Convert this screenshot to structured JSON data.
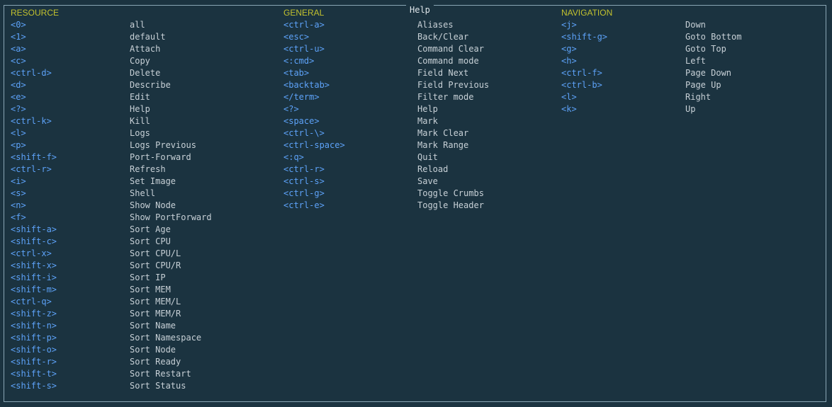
{
  "window": {
    "title": "Help"
  },
  "colors": {
    "background": "#1b3340",
    "border": "#8aa6b4",
    "section_title": "#c2c12e",
    "key": "#5da2f8",
    "description": "#c7d0d6"
  },
  "sections": [
    {
      "title": "RESOURCE",
      "items": [
        {
          "key": "<0>",
          "desc": "all"
        },
        {
          "key": "<1>",
          "desc": "default"
        },
        {
          "key": "<a>",
          "desc": "Attach"
        },
        {
          "key": "<c>",
          "desc": "Copy"
        },
        {
          "key": "<ctrl-d>",
          "desc": "Delete"
        },
        {
          "key": "<d>",
          "desc": "Describe"
        },
        {
          "key": "<e>",
          "desc": "Edit"
        },
        {
          "key": "<?>",
          "desc": "Help"
        },
        {
          "key": "<ctrl-k>",
          "desc": "Kill"
        },
        {
          "key": "<l>",
          "desc": "Logs"
        },
        {
          "key": "<p>",
          "desc": "Logs Previous"
        },
        {
          "key": "<shift-f>",
          "desc": "Port-Forward"
        },
        {
          "key": "<ctrl-r>",
          "desc": "Refresh"
        },
        {
          "key": "<i>",
          "desc": "Set Image"
        },
        {
          "key": "<s>",
          "desc": "Shell"
        },
        {
          "key": "<n>",
          "desc": "Show Node"
        },
        {
          "key": "<f>",
          "desc": "Show PortForward"
        },
        {
          "key": "<shift-a>",
          "desc": "Sort Age"
        },
        {
          "key": "<shift-c>",
          "desc": "Sort CPU"
        },
        {
          "key": "<ctrl-x>",
          "desc": "Sort CPU/L"
        },
        {
          "key": "<shift-x>",
          "desc": "Sort CPU/R"
        },
        {
          "key": "<shift-i>",
          "desc": "Sort IP"
        },
        {
          "key": "<shift-m>",
          "desc": "Sort MEM"
        },
        {
          "key": "<ctrl-q>",
          "desc": "Sort MEM/L"
        },
        {
          "key": "<shift-z>",
          "desc": "Sort MEM/R"
        },
        {
          "key": "<shift-n>",
          "desc": "Sort Name"
        },
        {
          "key": "<shift-p>",
          "desc": "Sort Namespace"
        },
        {
          "key": "<shift-o>",
          "desc": "Sort Node"
        },
        {
          "key": "<shift-r>",
          "desc": "Sort Ready"
        },
        {
          "key": "<shift-t>",
          "desc": "Sort Restart"
        },
        {
          "key": "<shift-s>",
          "desc": "Sort Status"
        }
      ]
    },
    {
      "title": "GENERAL",
      "items": [
        {
          "key": "<ctrl-a>",
          "desc": "Aliases"
        },
        {
          "key": "<esc>",
          "desc": "Back/Clear"
        },
        {
          "key": "<ctrl-u>",
          "desc": "Command Clear"
        },
        {
          "key": "<:cmd>",
          "desc": "Command mode"
        },
        {
          "key": "<tab>",
          "desc": "Field Next"
        },
        {
          "key": "<backtab>",
          "desc": "Field Previous"
        },
        {
          "key": "</term>",
          "desc": "Filter mode"
        },
        {
          "key": "<?>",
          "desc": "Help"
        },
        {
          "key": "<space>",
          "desc": "Mark"
        },
        {
          "key": "<ctrl-\\>",
          "desc": "Mark Clear"
        },
        {
          "key": "<ctrl-space>",
          "desc": "Mark Range"
        },
        {
          "key": "<:q>",
          "desc": "Quit"
        },
        {
          "key": "<ctrl-r>",
          "desc": "Reload"
        },
        {
          "key": "<ctrl-s>",
          "desc": "Save"
        },
        {
          "key": "<ctrl-g>",
          "desc": "Toggle Crumbs"
        },
        {
          "key": "<ctrl-e>",
          "desc": "Toggle Header"
        }
      ]
    },
    {
      "title": "NAVIGATION",
      "items": [
        {
          "key": "<j>",
          "desc": "Down"
        },
        {
          "key": "<shift-g>",
          "desc": "Goto Bottom"
        },
        {
          "key": "<g>",
          "desc": "Goto Top"
        },
        {
          "key": "<h>",
          "desc": "Left"
        },
        {
          "key": "<ctrl-f>",
          "desc": "Page Down"
        },
        {
          "key": "<ctrl-b>",
          "desc": "Page Up"
        },
        {
          "key": "<l>",
          "desc": "Right"
        },
        {
          "key": "<k>",
          "desc": "Up"
        }
      ]
    }
  ]
}
